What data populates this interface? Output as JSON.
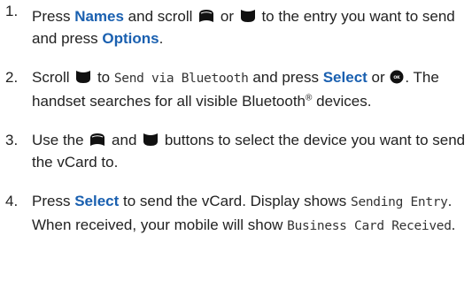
{
  "steps": [
    {
      "number": "1.",
      "t1": "Press ",
      "k1": "Names",
      "t2": " and scroll ",
      "t3": " or ",
      "t4": " to the entry you want to send and press ",
      "k2": "Options",
      "t5": "."
    },
    {
      "number": "2.",
      "t1": "Scroll ",
      "t2": " to ",
      "lcd1": "Send via Bluetooth",
      "t3": " and press ",
      "k1": "Select",
      "t4": " or ",
      "t5": ". The handset searches for all visible Bluetooth",
      "reg": "®",
      "t6": " devices."
    },
    {
      "number": "3.",
      "t1": "Use the ",
      "t2": " and ",
      "t3": " buttons to select the device you want to send the vCard to."
    },
    {
      "number": "4.",
      "t1": "Press ",
      "k1": "Select",
      "t2": " to send the vCard. Display shows ",
      "lcd1": "Sending Entry",
      "t3": ". When received, your mobile will show ",
      "lcd2": "Business Card Received",
      "t4": "."
    }
  ],
  "icons": {
    "scroll_up": "scroll-up-button-icon",
    "scroll_down": "scroll-down-button-icon",
    "ok": "ok-button-icon"
  },
  "colors": {
    "keyword": "#1a60b0",
    "text": "#222222"
  }
}
